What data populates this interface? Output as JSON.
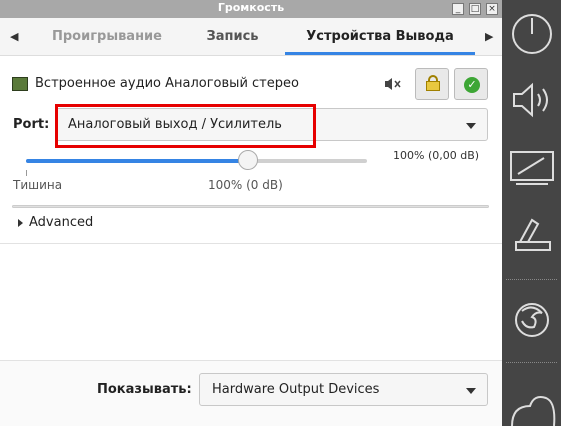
{
  "window": {
    "title": "Громкость",
    "controls": [
      "_",
      "□",
      "×"
    ]
  },
  "tabs": [
    {
      "label": "Проигрывание"
    },
    {
      "label": "Запись"
    },
    {
      "label": "Устройства Вывода"
    }
  ],
  "device": {
    "name": "Встроенное аудио Аналоговый стерео"
  },
  "port": {
    "label": "Port:",
    "value": "Аналоговый выход / Усилитель"
  },
  "volume": {
    "level_fraction": 0.65,
    "readout": "100% (0,00 dB)",
    "silence_label": "Тишина",
    "hundred_label": "100% (0 dB)"
  },
  "advanced": {
    "label": "Advanced"
  },
  "footer": {
    "show_label": "Показывать:",
    "show_value": "Hardware Output Devices"
  },
  "colors": {
    "accent": "#3584e4",
    "highlight": "#e60000",
    "panel": "#454545"
  },
  "panel_icons": [
    "power-icon",
    "speaker-icon",
    "display-icon",
    "scanner-icon",
    "firefox-icon",
    "cloud-icon"
  ]
}
